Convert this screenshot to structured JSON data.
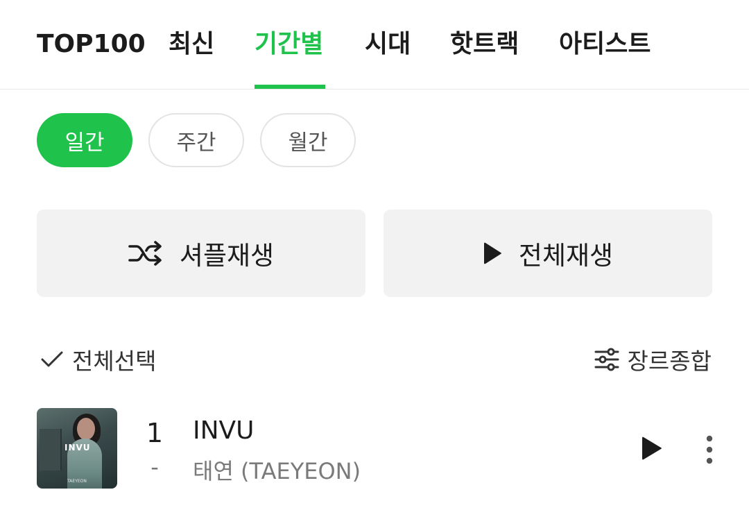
{
  "tabs": [
    {
      "label": "TOP100",
      "active": false
    },
    {
      "label": "최신",
      "active": false
    },
    {
      "label": "기간별",
      "active": true
    },
    {
      "label": "시대",
      "active": false
    },
    {
      "label": "핫트랙",
      "active": false
    },
    {
      "label": "아티스트",
      "active": false
    }
  ],
  "period_chips": [
    {
      "label": "일간",
      "active": true
    },
    {
      "label": "주간",
      "active": false
    },
    {
      "label": "월간",
      "active": false
    }
  ],
  "actions": {
    "shuffle_label": "셔플재생",
    "play_all_label": "전체재생"
  },
  "list_controls": {
    "select_all_label": "전체선택",
    "genre_label": "장르종합"
  },
  "chart_list": [
    {
      "rank": "1",
      "rank_change": "-",
      "title": "INVU",
      "artist": "태연 (TAEYEON)",
      "cover_text": "INVU",
      "cover_subtext": "TAEYEON"
    }
  ],
  "colors": {
    "accent": "#1fc24a",
    "button_bg": "#f2f2f2",
    "chip_border": "#e3e3e3"
  },
  "icons": {
    "shuffle": "shuffle-icon",
    "play": "play-icon",
    "check": "check-icon",
    "filter": "sliders-icon",
    "more": "more-vertical-icon"
  }
}
